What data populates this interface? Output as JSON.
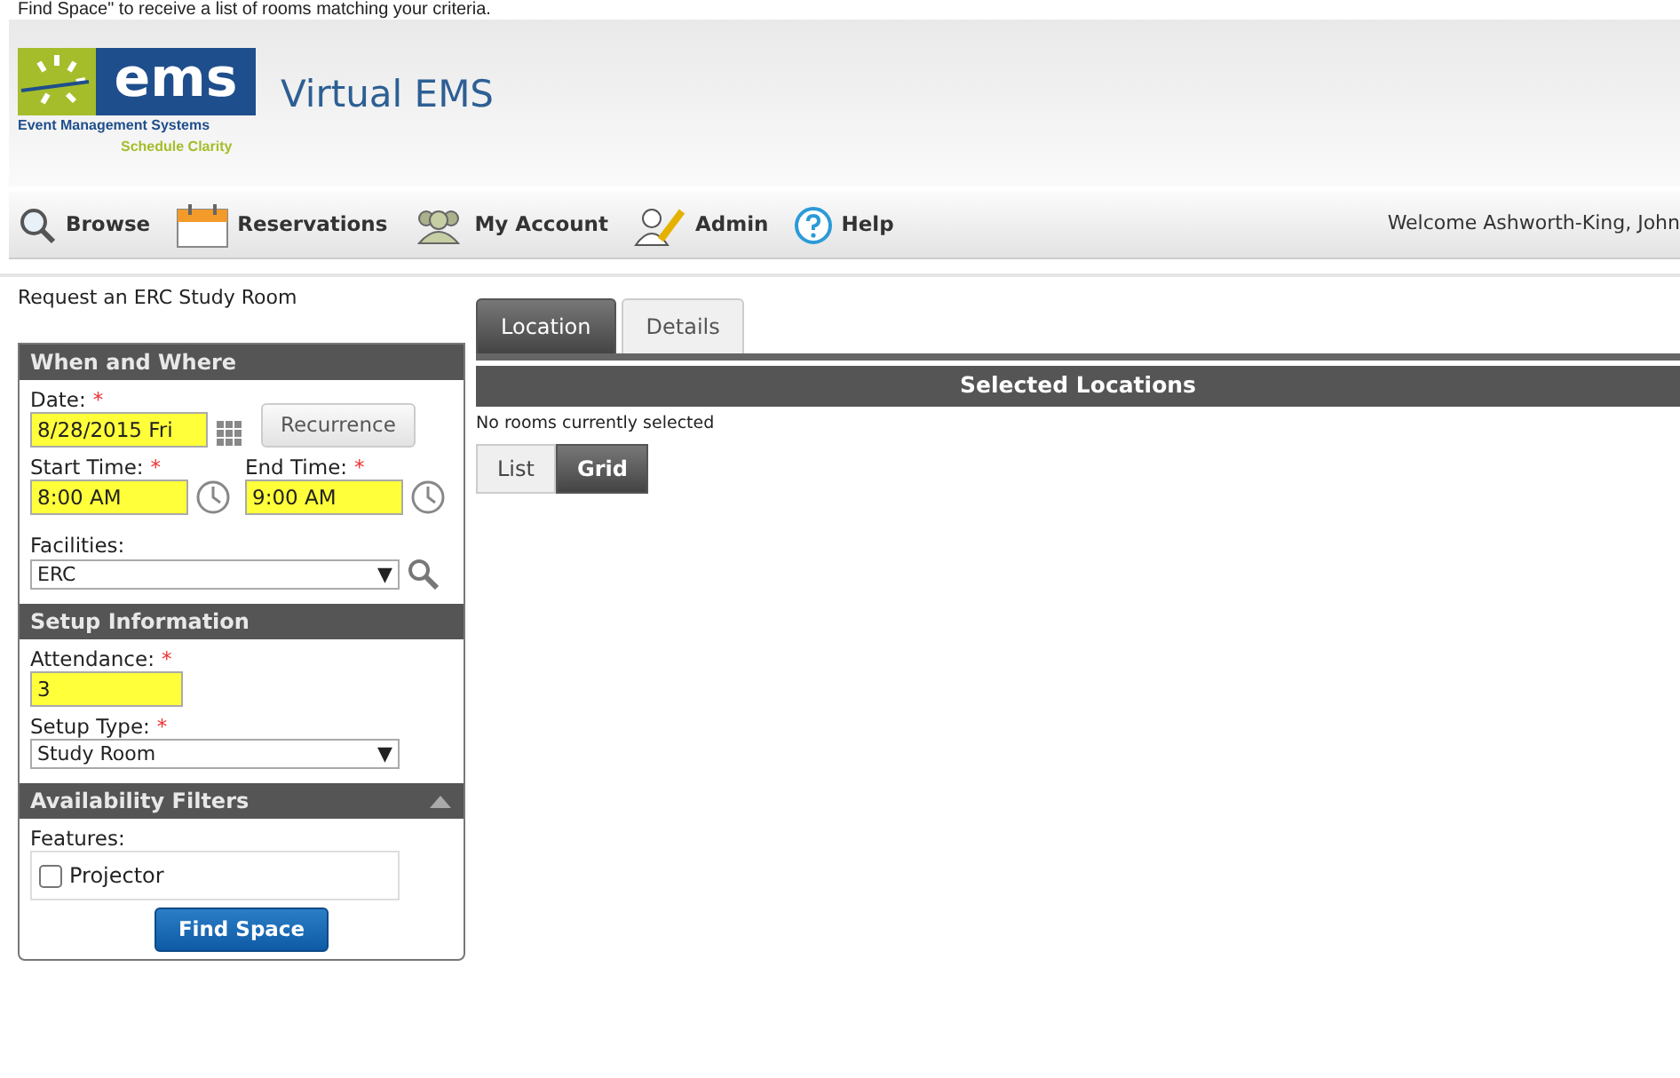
{
  "caption": "Find Space\" to receive a list of rooms matching your criteria.",
  "header": {
    "logo_text": "ems",
    "logo_line1": "Event Management Systems",
    "logo_line2": "Schedule Clarity",
    "title": "Virtual EMS"
  },
  "nav": [
    {
      "kind": "search",
      "label": "Browse"
    },
    {
      "kind": "calendar",
      "label": "Reservations"
    },
    {
      "kind": "people",
      "label": "My Account"
    },
    {
      "kind": "pen",
      "label": "Admin"
    },
    {
      "kind": "help",
      "label": "Help"
    }
  ],
  "welcome": "Welcome Ashworth-King, John",
  "page_title": "Request an ERC Study Room",
  "sections": [
    {
      "title": "When and Where",
      "collapsible": false,
      "fields": [
        {
          "kind": "date",
          "label": "Date:",
          "required_mark": "*",
          "value": "8/28/2015 Fri",
          "highlighted": true,
          "button": "Recurrence"
        },
        {
          "kind": "times",
          "items": [
            {
              "label": "Start Time:",
              "required_mark": "*",
              "value": "8:00 AM",
              "highlighted": true
            },
            {
              "label": "End Time:",
              "required_mark": "*",
              "value": "9:00 AM",
              "highlighted": true
            }
          ]
        },
        {
          "kind": "select",
          "label": "Facilities:",
          "value": "ERC",
          "arrow": "▼",
          "search": true
        }
      ]
    },
    {
      "title": "Setup Information",
      "collapsible": false,
      "fields": [
        {
          "kind": "text",
          "label": "Attendance:",
          "required_mark": "*",
          "value": "3",
          "highlighted": true
        },
        {
          "kind": "select",
          "label": "Setup Type:",
          "required_mark": "*",
          "value": "Study Room",
          "arrow": "▼",
          "search": false
        }
      ]
    },
    {
      "title": "Availability Filters",
      "collapsible": true,
      "fields": [
        {
          "kind": "checks",
          "label": "Features:",
          "items": [
            {
              "label": "Projector",
              "checked": false
            }
          ]
        }
      ]
    }
  ],
  "find_button": "Find Space",
  "tabs": [
    {
      "label": "Location",
      "selected": true
    },
    {
      "label": "Details",
      "selected": false
    }
  ],
  "selected_header": "Selected Locations",
  "selected_note": "No rooms currently selected",
  "views": [
    {
      "label": "List",
      "selected": false
    },
    {
      "label": "Grid",
      "selected": true
    }
  ]
}
